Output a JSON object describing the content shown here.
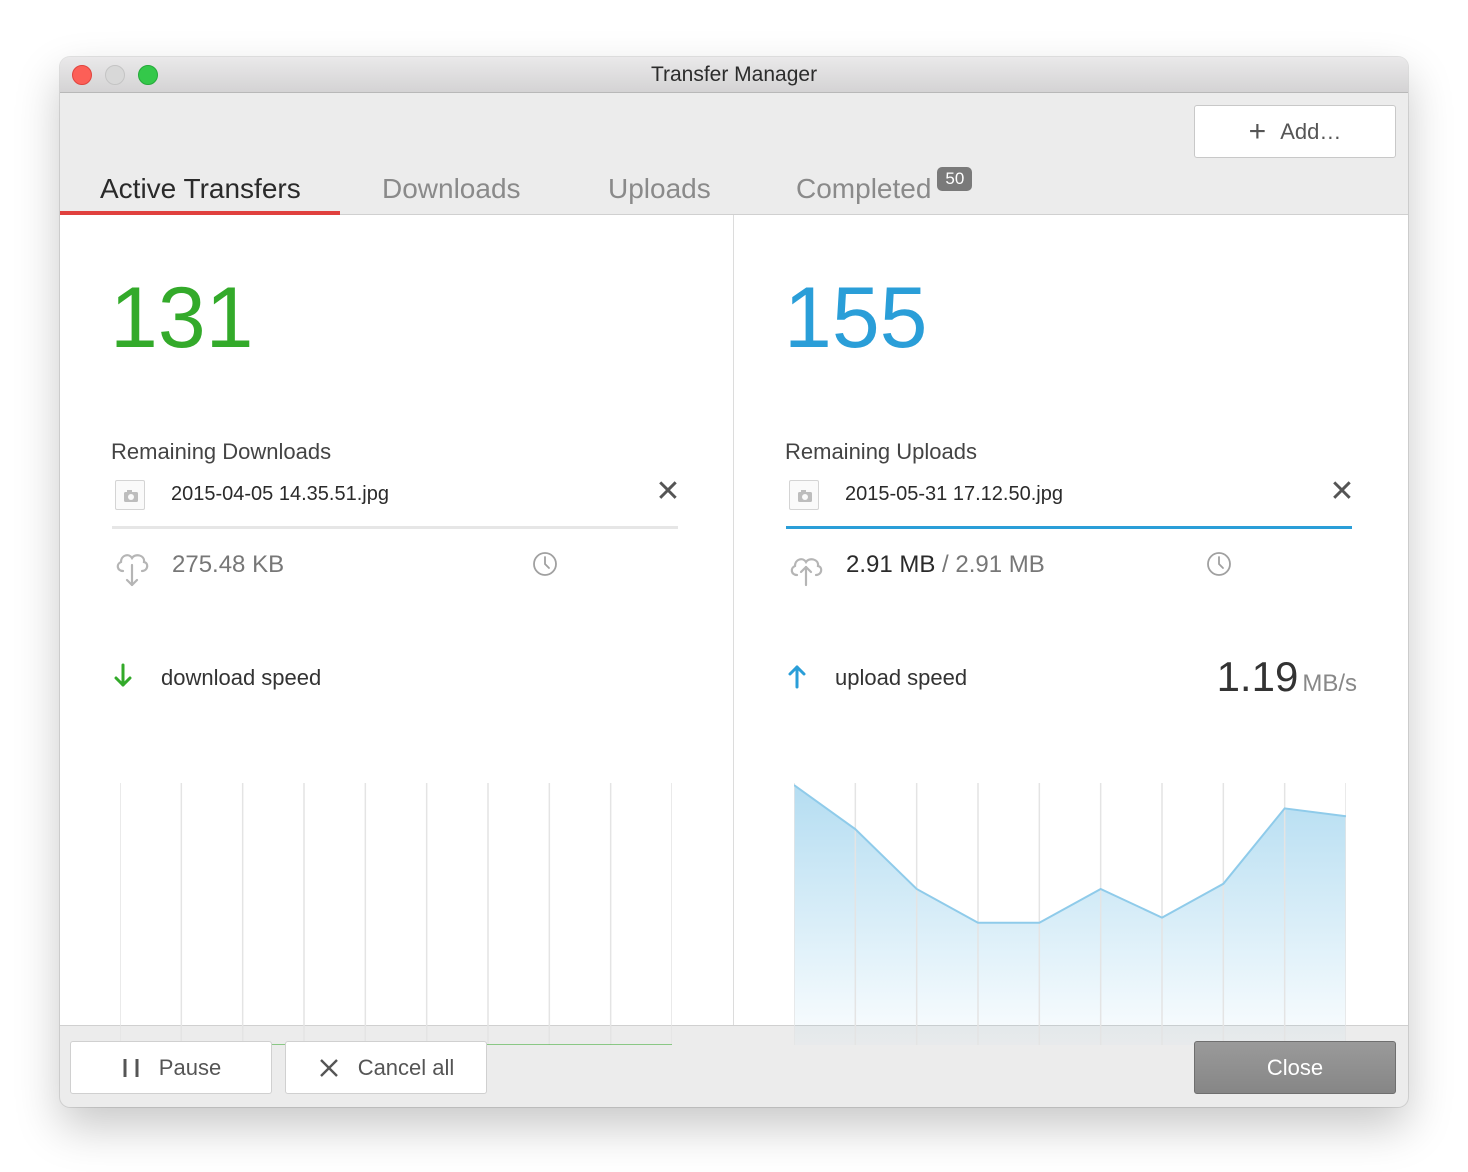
{
  "window": {
    "title": "Transfer Manager"
  },
  "toolbar": {
    "add_label": "Add…"
  },
  "tabs": [
    {
      "label": "Active Transfers",
      "active": true
    },
    {
      "label": "Downloads"
    },
    {
      "label": "Uploads"
    },
    {
      "label": "Completed",
      "badge": "50"
    }
  ],
  "downloads": {
    "remaining_count": "131",
    "remaining_label": "Remaining Downloads",
    "file_name": "2015-04-05 14.35.51.jpg",
    "size": "275.48 KB",
    "progress": 0.0,
    "speed_label": "download speed",
    "color": "#33aa2a"
  },
  "uploads": {
    "remaining_count": "155",
    "remaining_label": "Remaining Uploads",
    "file_name": "2015-05-31 17.12.50.jpg",
    "size_done": "2.91 MB",
    "size_sep": " / ",
    "size_total": "2.91 MB",
    "progress": 1.0,
    "speed_label": "upload speed",
    "speed_value": "1.19",
    "speed_unit": "MB/s",
    "color": "#2a9ed8"
  },
  "chart_data": [
    {
      "type": "line",
      "x": [
        0,
        1,
        2,
        3,
        4,
        5,
        6,
        7,
        8,
        9
      ],
      "values": [
        0,
        0,
        0,
        0,
        0,
        0,
        0,
        0,
        0,
        0
      ],
      "series_color": "#33aa2a"
    },
    {
      "type": "area",
      "x": [
        0,
        1,
        2,
        3,
        4,
        5,
        6,
        7,
        8,
        9
      ],
      "values": [
        1.0,
        0.83,
        0.6,
        0.47,
        0.47,
        0.6,
        0.49,
        0.62,
        0.91,
        0.88
      ],
      "series_color": "#2a9ed8"
    }
  ],
  "footer": {
    "pause_label": "Pause",
    "cancel_label": "Cancel all",
    "close_label": "Close"
  }
}
